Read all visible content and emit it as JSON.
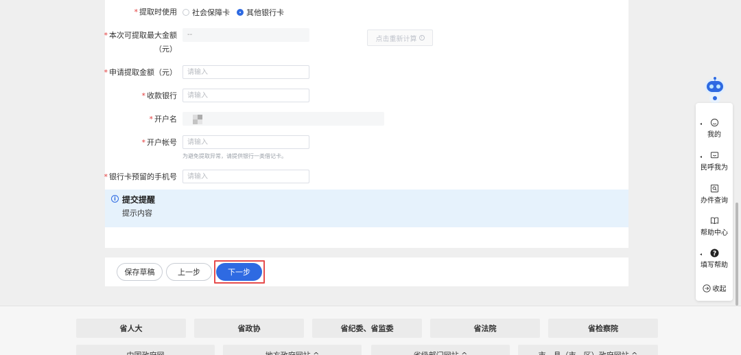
{
  "form": {
    "withdraw_use": {
      "label": "提取时使用",
      "options": [
        {
          "label": "社会保障卡",
          "checked": false
        },
        {
          "label": "其他银行卡",
          "checked": true
        }
      ]
    },
    "max_amount": {
      "label_line1": "本次可提取最大金额",
      "label_line2": "（元）",
      "value": "--",
      "button": "点击重新计算"
    },
    "apply_amount": {
      "label": "申请提取金额（元）",
      "placeholder": "请输入"
    },
    "bank": {
      "label": "收款银行",
      "placeholder": "请输入"
    },
    "account_name": {
      "label": "开户名"
    },
    "account_no": {
      "label": "开户帐号",
      "placeholder": "请输入",
      "hint": "为避免提取异常，请提供银行一类借记卡。"
    },
    "phone": {
      "label": "银行卡预留的手机号",
      "placeholder": "请输入"
    },
    "required_mark": "*"
  },
  "notice": {
    "title": "提交提醒",
    "body": "提示内容"
  },
  "actions": {
    "save_draft": "保存草稿",
    "prev": "上一步",
    "next": "下一步"
  },
  "footer": {
    "row1": [
      "省人大",
      "省政协",
      "省纪委、省监委",
      "省法院",
      "省检察院"
    ],
    "row2": [
      "中国政府网",
      "地方政府网站 ^",
      "省级部门网站 ^",
      "市、县（市、区）政府网站 ^"
    ]
  },
  "side": {
    "items": [
      "我的",
      "民呼我为",
      "办件查询",
      "帮助中心",
      "填写帮助"
    ],
    "collapse": "收起"
  },
  "colors": {
    "primary": "#2e6ae2",
    "required": "#e23c3c",
    "highlight": "#e64b4b",
    "notice_bg": "#e6f2fc"
  }
}
